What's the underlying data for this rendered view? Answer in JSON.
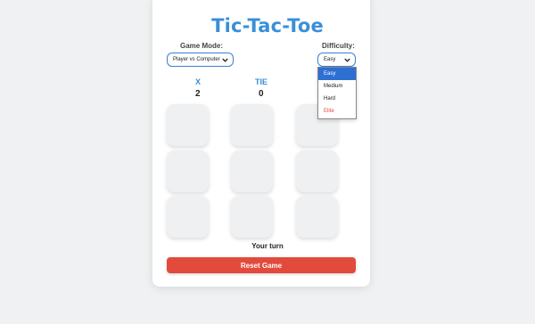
{
  "title": "Tic-Tac-Toe",
  "colors": {
    "accent": "#3a8fd8",
    "reset": "#e24a3b",
    "elite": "#e24a3b",
    "selected": "#2e6fd2"
  },
  "game_mode": {
    "label": "Game Mode:",
    "value": "Player vs Computer"
  },
  "difficulty": {
    "label": "Difficulty:",
    "value": "Easy",
    "options": [
      "Easy",
      "Medium",
      "Hard",
      "Elite"
    ],
    "selected_index": 0
  },
  "scores": [
    {
      "label": "X",
      "value": "2"
    },
    {
      "label": "TIE",
      "value": "0"
    }
  ],
  "board": [
    "",
    "",
    "",
    "",
    "",
    "",
    "",
    "",
    ""
  ],
  "status": "Your turn",
  "reset_label": "Reset Game"
}
